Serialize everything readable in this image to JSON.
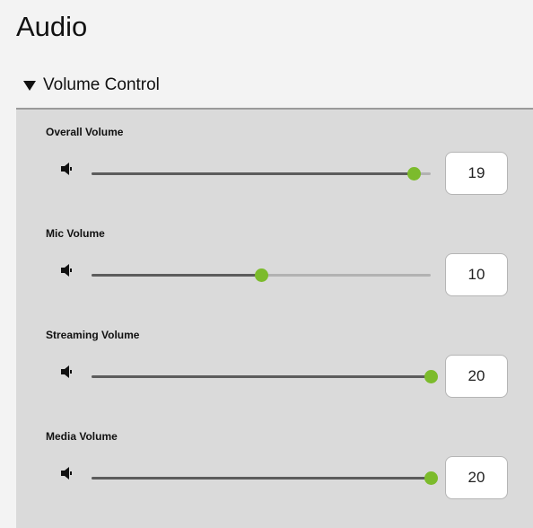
{
  "page": {
    "title": "Audio"
  },
  "section": {
    "label": "Volume Control",
    "expanded": true
  },
  "colors": {
    "accent": "#7cbb2c",
    "track_filled": "#5c5c5c",
    "track_empty": "#b2b2b2",
    "panel_bg": "#dadada"
  },
  "sliders": [
    {
      "label": "Overall Volume",
      "value": "19",
      "min": 0,
      "max": 20,
      "icon": "speaker-icon"
    },
    {
      "label": "Mic Volume",
      "value": "10",
      "min": 0,
      "max": 20,
      "icon": "speaker-icon"
    },
    {
      "label": "Streaming Volume",
      "value": "20",
      "min": 0,
      "max": 20,
      "icon": "speaker-icon"
    },
    {
      "label": "Media Volume",
      "value": "20",
      "min": 0,
      "max": 20,
      "icon": "speaker-icon"
    }
  ]
}
